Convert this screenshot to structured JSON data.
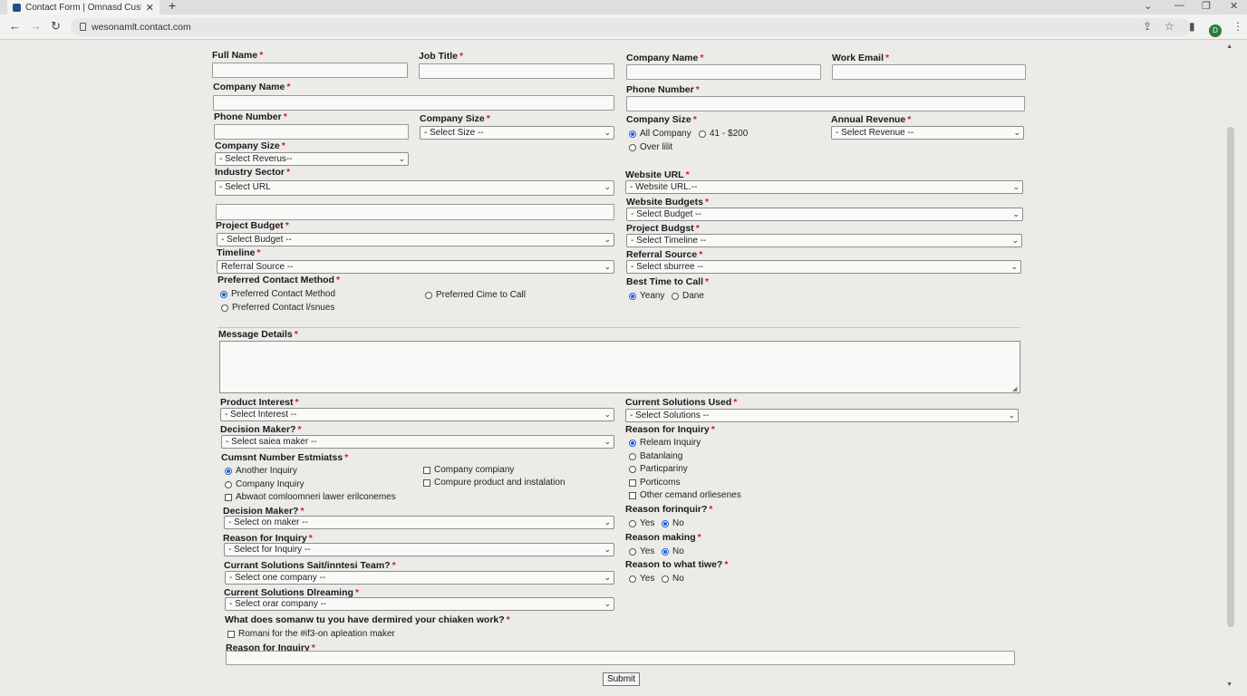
{
  "browser": {
    "tab_title": "Contact Form | Omnasd Custom",
    "url": "wesonamlt.contact.com",
    "profile_initial": "D"
  },
  "form": {
    "full_name": {
      "label": "Full Name"
    },
    "job_title": {
      "label": "Job Title"
    },
    "company_name_r": {
      "label": "Company Name"
    },
    "work_email": {
      "label": "Work Email"
    },
    "company_name_l": {
      "label": "Company Name"
    },
    "phone_number_r": {
      "label": "Phone Number"
    },
    "phone_number_l": {
      "label": "Phone Number"
    },
    "company_size_mid": {
      "label": "Company Size",
      "value": "- Select Size --"
    },
    "company_size_r": {
      "label": "Company Size",
      "options": [
        "All Company",
        "41 - $200",
        "Over lilit"
      ]
    },
    "annual_revenue": {
      "label": "Annual Revenue",
      "value": "- Select Revenue --"
    },
    "company_size_l": {
      "label": "Company Size",
      "value": "- Select Reverus--"
    },
    "industry_sector": {
      "label": "Industry Sector",
      "value": "- Select URL"
    },
    "website_url": {
      "label": "Website URL",
      "value": "- Website URL.--"
    },
    "website_budgets": {
      "label": "Website Budgets",
      "value": "- Select Budget --"
    },
    "project_budget_l": {
      "label": "Project Budget",
      "value": "- Select Budget --"
    },
    "project_budget_r": {
      "label": "Project Budgst",
      "value": "- Select Timeline --"
    },
    "timeline": {
      "label": "Timeline",
      "value": "Referral Source --"
    },
    "referral_source": {
      "label": "Referral Source",
      "value": "- Select sburree --"
    },
    "preferred_contact": {
      "label": "Preferred Contact Method",
      "options": [
        "Preferred Contact Method",
        "Preferred Cime to Call",
        "Preferred Contact l/snues"
      ]
    },
    "best_time": {
      "label": "Best Time to Call",
      "options": [
        "Yeany",
        "Dane"
      ]
    },
    "message": {
      "label": "Message Details"
    },
    "product_interest": {
      "label": "Product Interest",
      "value": "- Select Interest --"
    },
    "current_solutions_used": {
      "label": "Current Solutions Used",
      "value": "- Select Solutions --"
    },
    "decision_maker_1": {
      "label": "Decision Maker?",
      "value": "- Select saiea maker --"
    },
    "reason_inquiry_r": {
      "label": "Reason for Inquiry",
      "options": [
        "Releam Inquiry",
        "Batanlaing",
        "Particpariny",
        "Porticoms",
        "Other cemand orliesenes"
      ]
    },
    "cumsnt": {
      "label": "Cumsnt Number Estmiatss",
      "options": [
        "Another Inquiry",
        "Company compiany",
        "Company Inquiry",
        "Compure product and instalation",
        "Abwaot comloomneri lawer erilconemes"
      ]
    },
    "decision_maker_2": {
      "label": "Decision Maker?",
      "value": "- Select on maker --"
    },
    "reason_forinquir": {
      "label": "Reason forinquir?",
      "options": [
        "Yes",
        "No"
      ]
    },
    "reason_inquiry_l": {
      "label": "Reason for Inquiry",
      "value": "- Select for Inquiry --"
    },
    "reason_making": {
      "label": "Reason making",
      "options": [
        "Yes",
        "No"
      ]
    },
    "current_solutions_team": {
      "label": "Currant Solutions Sait/inntesi Team?",
      "value": "- Select one company --"
    },
    "reason_what": {
      "label": "Reason to what tiwe?",
      "options": [
        "Yes",
        "No"
      ]
    },
    "current_solutions_dreaming": {
      "label": "Current Solutions Dlreaming",
      "value": "- Select orar company --"
    },
    "what_does": {
      "label": "What does somanw tu you have dermired your chiaken work?",
      "option": "Romani for the #if3-on apleation maker"
    },
    "reason_inquiry_bottom": {
      "label": "Reason for Inquiry"
    },
    "required_mark": "*",
    "submit_label": "Submit"
  },
  "icons": [
    "back-arrow-icon",
    "forward-arrow-icon",
    "reload-icon",
    "lock-icon",
    "share-icon",
    "star-icon",
    "sidepanel-icon",
    "menu-icon"
  ]
}
